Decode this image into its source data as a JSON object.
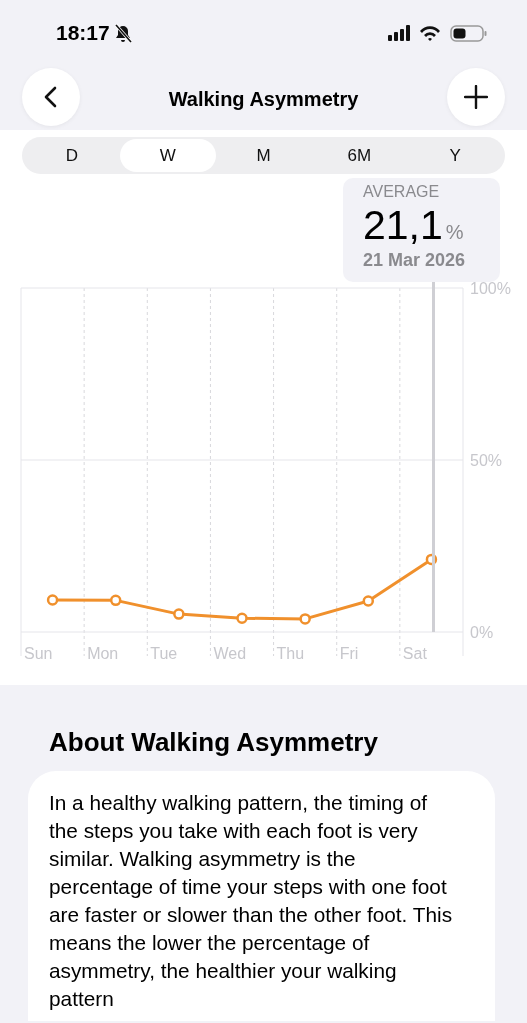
{
  "status_bar": {
    "time": "18:17"
  },
  "nav": {
    "title": "Walking Asymmetry"
  },
  "range_tabs": [
    {
      "label": "D",
      "selected": false
    },
    {
      "label": "W",
      "selected": true
    },
    {
      "label": "M",
      "selected": false
    },
    {
      "label": "6M",
      "selected": false
    },
    {
      "label": "Y",
      "selected": false
    }
  ],
  "summary": {
    "label": "AVERAGE",
    "value": "21,1",
    "unit": "%",
    "date": "21 Mar 2026"
  },
  "chart": {
    "chart_data": {
      "type": "line",
      "categories": [
        "Sun",
        "Mon",
        "Tue",
        "Wed",
        "Thu",
        "Fri",
        "Sat"
      ],
      "values": [
        9.3,
        9.2,
        5.2,
        4,
        3.8,
        9,
        21.1
      ],
      "marker": "circle",
      "ylim": [
        0,
        100
      ],
      "yticks": [
        {
          "value": 0,
          "label": "0%"
        },
        {
          "value": 50,
          "label": "50%"
        },
        {
          "value": 100,
          "label": "100%"
        }
      ]
    }
  },
  "about": {
    "heading": "About Walking Asymmetry",
    "text": "In a healthy walking pattern, the timing of the steps you take with each foot is very similar. Walking asymmetry is the percentage of time your steps with one foot are faster or slower than the other foot. This means the lower the percentage of asymmetry, the healthier your walking pattern"
  }
}
